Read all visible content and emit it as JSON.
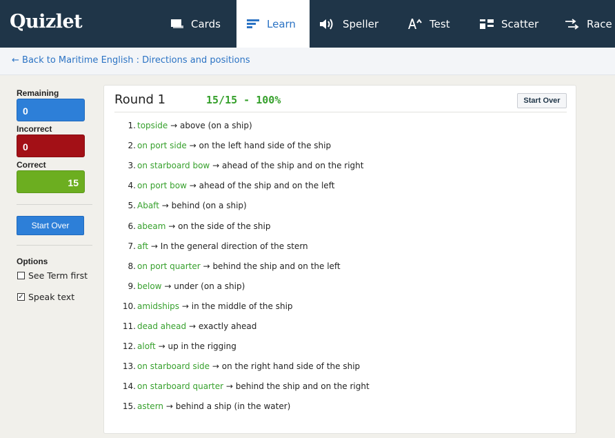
{
  "app": {
    "logo": "Quizlet"
  },
  "nav": {
    "tabs": [
      {
        "label": "Cards",
        "icon": "cards-icon",
        "active": false
      },
      {
        "label": "Learn",
        "icon": "learn-icon",
        "active": true
      },
      {
        "label": "Speller",
        "icon": "speaker-icon",
        "active": false
      },
      {
        "label": "Test",
        "icon": "test-icon",
        "active": false
      },
      {
        "label": "Scatter",
        "icon": "scatter-icon",
        "active": false
      },
      {
        "label": "Race",
        "icon": "race-icon",
        "active": false
      }
    ]
  },
  "breadcrumb": {
    "arrow": "←",
    "text": "Back to Maritime English : Directions and positions"
  },
  "sidebar": {
    "remaining_label": "Remaining",
    "remaining_value": "0",
    "incorrect_label": "Incorrect",
    "incorrect_value": "0",
    "correct_label": "Correct",
    "correct_value": "15",
    "start_over": "Start Over",
    "options_label": "Options",
    "options": [
      {
        "label": "See Term first",
        "checked": false
      },
      {
        "label": "Speak text",
        "checked": true
      }
    ]
  },
  "main": {
    "round": "Round 1",
    "score": "15/15 - 100%",
    "start_over": "Start Over",
    "arrow": "→",
    "items": [
      {
        "num": "1.",
        "term": "topside",
        "definition": "above (on a ship)"
      },
      {
        "num": "2.",
        "term": "on port side",
        "definition": "on the left hand side of the ship"
      },
      {
        "num": "3.",
        "term": "on starboard bow",
        "definition": "ahead of the ship and on the right"
      },
      {
        "num": "4.",
        "term": "on port bow",
        "definition": "ahead of the ship and on the left"
      },
      {
        "num": "5.",
        "term": "Abaft",
        "definition": "behind (on a ship)"
      },
      {
        "num": "6.",
        "term": "abeam",
        "definition": "on the side of the ship"
      },
      {
        "num": "7.",
        "term": "aft",
        "definition": "In the general direction of the stern"
      },
      {
        "num": "8.",
        "term": "on port quarter",
        "definition": "behind the ship and on the left"
      },
      {
        "num": "9.",
        "term": "below",
        "definition": "under (on a ship)"
      },
      {
        "num": "10.",
        "term": "amidships",
        "definition": "in the middle of the ship"
      },
      {
        "num": "11.",
        "term": "dead ahead",
        "definition": "exactly ahead"
      },
      {
        "num": "12.",
        "term": "aloft",
        "definition": "up in the rigging"
      },
      {
        "num": "13.",
        "term": "on starboard side",
        "definition": "on the right hand side of the ship"
      },
      {
        "num": "14.",
        "term": "on starboard quarter",
        "definition": "behind the ship and on the right"
      },
      {
        "num": "15.",
        "term": "astern",
        "definition": "behind a ship (in the water)"
      }
    ]
  },
  "colors": {
    "nav_bg": "#1f3548",
    "link_blue": "#2b73c4",
    "term_green": "#36a02c",
    "remaining_blue": "#2d7fd8",
    "incorrect_red": "#a31016",
    "correct_green": "#6cae20"
  }
}
